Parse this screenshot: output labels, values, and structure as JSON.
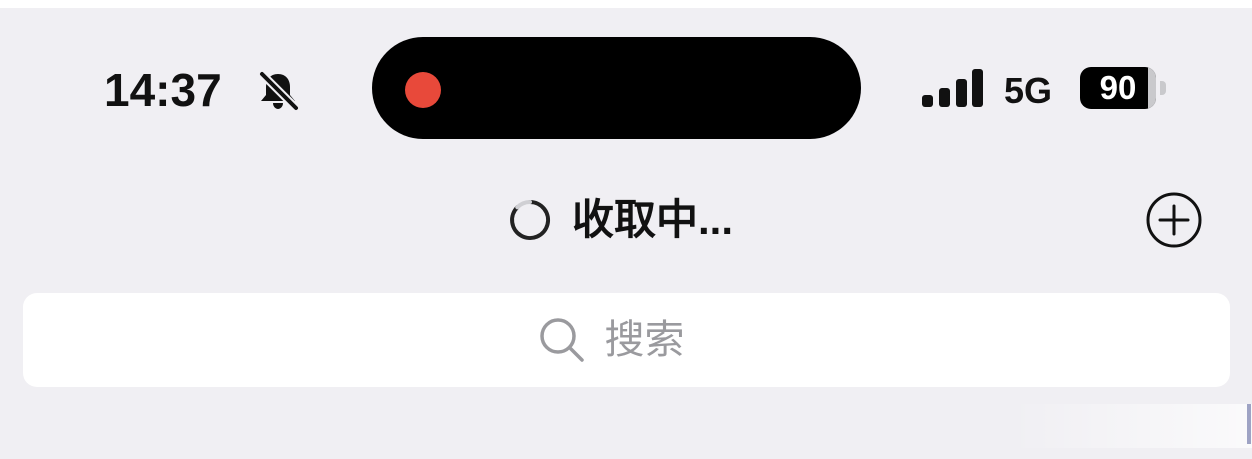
{
  "status_bar": {
    "time": "14:37",
    "network": "5G",
    "battery_level": "90",
    "battery_fraction": 0.9,
    "icons": [
      "bell-slash-icon",
      "signal-icon",
      "battery-icon"
    ]
  },
  "recording_indicator": {
    "color": "#e8493a"
  },
  "nav": {
    "title": "收取中...",
    "icons": [
      "spinner-icon",
      "add-circle-icon"
    ]
  },
  "search": {
    "placeholder": "搜索",
    "icon": "search-icon"
  },
  "colors": {
    "background": "#f0eff3",
    "island": "#000000",
    "text": "#111111",
    "placeholder": "#9a9a9e"
  }
}
